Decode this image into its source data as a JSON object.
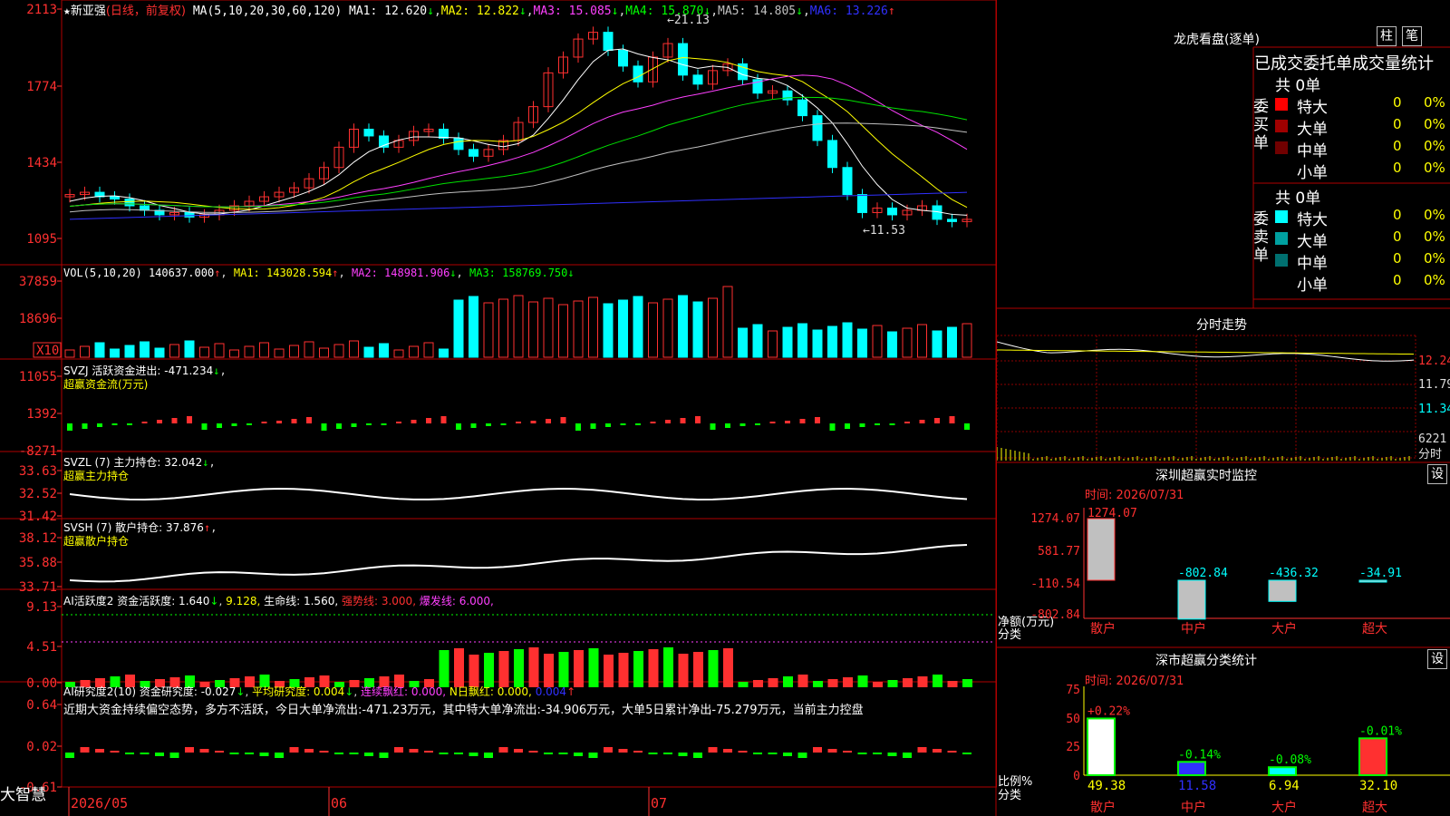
{
  "colors": {
    "up": "#ff3030",
    "down": "#00ffff",
    "grid": "#8b0000",
    "border": "#b00000",
    "ma1": "#ffffff",
    "ma2": "#ffff00",
    "ma3": "#ff40ff",
    "ma4": "#00e000",
    "ma5": "#c0c0c0",
    "ma6": "#3030ff"
  },
  "header": {
    "star": "★",
    "stock": "新亚强",
    "mode": "(日线，前复权)",
    "ma_params": "MA(5,10,20,30,60,120)",
    "ma1": "MA1: 12.620",
    "ma2": "MA2: 12.822",
    "ma3": "MA3: 15.085",
    "ma4": "MA4: 15.870",
    "ma5": "MA5: 14.805",
    "ma6": "MA6: 13.226"
  },
  "price_axis": [
    "2113",
    "1774",
    "1434",
    "1095"
  ],
  "price_marks": {
    "high": "21.13",
    "low": "11.53"
  },
  "vol": {
    "header": "VOL(5,10,20)",
    "value": "140637.000",
    "ma1": "MA1: 143028.594",
    "ma2": "MA2: 148981.906",
    "ma3": "MA3: 158769.750",
    "axis": [
      "37859",
      "18696"
    ],
    "unit": "X10"
  },
  "svzj": {
    "header": "SVZJ  活跃资金进出: -471.234",
    "sub": "超赢资金流(万元)",
    "axis": [
      "11055",
      "1392",
      "-8271"
    ]
  },
  "svzl": {
    "header": "SVZL (7) 主力持仓: 32.042",
    "sub": "超赢主力持仓",
    "axis": [
      "33.63",
      "32.52",
      "31.42"
    ]
  },
  "svsh": {
    "header": "SVSH (7) 散户持仓: 37.876",
    "sub": "超赢散户持仓",
    "axis": [
      "38.12",
      "35.88",
      "33.71"
    ]
  },
  "ai1": {
    "header_a": "AI活跃度2 资金活跃度: 1.640",
    "header_b": "9.128,",
    "header_c": "生命线: 1.560,",
    "header_d": "强势线: 3.000,",
    "header_e": "爆发线: 6.000,",
    "axis": [
      "9.13",
      "4.51",
      "0.00"
    ]
  },
  "ai2": {
    "header_a": "AI研究度2(10) 资金研究度: -0.027",
    "header_b": "平均研究度: 0.004",
    "header_c": "连续飘红: 0.000,",
    "header_d": "N日飘红: 0.000,",
    "header_e": "0.004",
    "text": "近期大资金持续偏空态势，多方不活跃，今日大单净流出:-471.23万元，其中特大单净流出:-34.906万元，大单5日累计净出-75.279万元，当前主力控盘",
    "axis": [
      "0.64",
      "0.02",
      "-0.61"
    ]
  },
  "bottom": {
    "logo": "大智慧",
    "dates": [
      "2026/05",
      "06",
      "07"
    ]
  },
  "right": {
    "lhkp": "龙虎看盘(逐单)",
    "btn1": "柱",
    "btn2": "笔",
    "stat_title": "已成交委托单成交量统计",
    "buy_label": "委买单",
    "sell_label": "委卖单",
    "buy_total": "共 0单",
    "sell_total": "共 0单",
    "rows_buy": [
      {
        "name": "特大",
        "v": "0",
        "p": "0%",
        "c": "#ff0000"
      },
      {
        "name": "大单",
        "v": "0",
        "p": "0%",
        "c": "#a00000"
      },
      {
        "name": "中单",
        "v": "0",
        "p": "0%",
        "c": "#700000"
      },
      {
        "name": "小单",
        "v": "0",
        "p": "0%",
        "c": ""
      }
    ],
    "rows_sell": [
      {
        "name": "特大",
        "v": "0",
        "p": "0%",
        "c": "#00ffff"
      },
      {
        "name": "大单",
        "v": "0",
        "p": "0%",
        "c": "#00a0a0"
      },
      {
        "name": "中单",
        "v": "0",
        "p": "0%",
        "c": "#007070"
      },
      {
        "name": "小单",
        "v": "0",
        "p": "0%",
        "c": ""
      }
    ],
    "fszs": "分时走势",
    "fs_axis": [
      "12.24",
      "11.79",
      "11.34",
      "6221",
      "分时"
    ],
    "sz_title": "深圳超赢实时监控",
    "sz_btn": "设",
    "sz_time": "时间: 2026/07/31",
    "sz_axis": [
      "1274.07",
      "581.77",
      "-110.54",
      "-802.84"
    ],
    "sz_unit": "净额(万元)",
    "sz_unit2": "分类",
    "sz_bars": [
      {
        "cat": "散户",
        "val": 1274.07,
        "label": "1274.07"
      },
      {
        "cat": "中户",
        "val": -802.84,
        "label": "-802.84"
      },
      {
        "cat": "大户",
        "val": -436.32,
        "label": "-436.32"
      },
      {
        "cat": "超大",
        "val": -34.91,
        "label": "-34.91"
      }
    ],
    "cls_title": "深市超赢分类统计",
    "cls_btn": "设",
    "cls_time": "时间: 2026/07/31",
    "cls_axis": [
      "75",
      "50",
      "25",
      "0"
    ],
    "cls_unit": "比例%",
    "cls_unit2": "分类",
    "cls_bars": [
      {
        "cat": "散户",
        "val": 49.38,
        "chg": "+0.22%",
        "label": "49.38",
        "c": "#ffffff"
      },
      {
        "cat": "中户",
        "val": 11.58,
        "chg": "-0.14%",
        "label": "11.58",
        "c": "#3030ff"
      },
      {
        "cat": "大户",
        "val": 6.94,
        "chg": "-0.08%",
        "label": "6.94",
        "c": "#00ffff"
      },
      {
        "cat": "超大",
        "val": 32.1,
        "chg": "-0.01%",
        "label": "32.10",
        "c": "#ff3030"
      }
    ]
  }
}
